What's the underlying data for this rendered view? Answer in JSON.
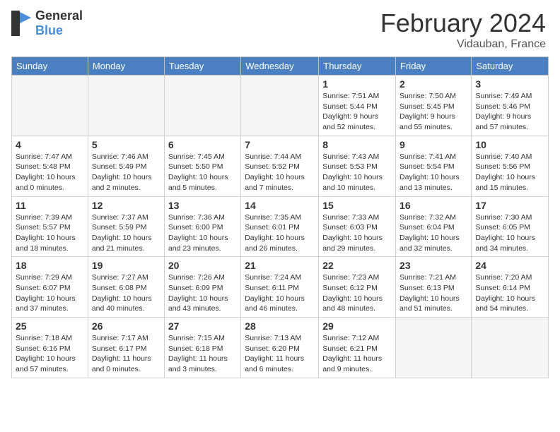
{
  "header": {
    "logo_general": "General",
    "logo_blue": "Blue",
    "month_title": "February 2024",
    "location": "Vidauban, France"
  },
  "days_of_week": [
    "Sunday",
    "Monday",
    "Tuesday",
    "Wednesday",
    "Thursday",
    "Friday",
    "Saturday"
  ],
  "weeks": [
    [
      {
        "day": "",
        "info": ""
      },
      {
        "day": "",
        "info": ""
      },
      {
        "day": "",
        "info": ""
      },
      {
        "day": "",
        "info": ""
      },
      {
        "day": "1",
        "info": "Sunrise: 7:51 AM\nSunset: 5:44 PM\nDaylight: 9 hours\nand 52 minutes."
      },
      {
        "day": "2",
        "info": "Sunrise: 7:50 AM\nSunset: 5:45 PM\nDaylight: 9 hours\nand 55 minutes."
      },
      {
        "day": "3",
        "info": "Sunrise: 7:49 AM\nSunset: 5:46 PM\nDaylight: 9 hours\nand 57 minutes."
      }
    ],
    [
      {
        "day": "4",
        "info": "Sunrise: 7:47 AM\nSunset: 5:48 PM\nDaylight: 10 hours\nand 0 minutes."
      },
      {
        "day": "5",
        "info": "Sunrise: 7:46 AM\nSunset: 5:49 PM\nDaylight: 10 hours\nand 2 minutes."
      },
      {
        "day": "6",
        "info": "Sunrise: 7:45 AM\nSunset: 5:50 PM\nDaylight: 10 hours\nand 5 minutes."
      },
      {
        "day": "7",
        "info": "Sunrise: 7:44 AM\nSunset: 5:52 PM\nDaylight: 10 hours\nand 7 minutes."
      },
      {
        "day": "8",
        "info": "Sunrise: 7:43 AM\nSunset: 5:53 PM\nDaylight: 10 hours\nand 10 minutes."
      },
      {
        "day": "9",
        "info": "Sunrise: 7:41 AM\nSunset: 5:54 PM\nDaylight: 10 hours\nand 13 minutes."
      },
      {
        "day": "10",
        "info": "Sunrise: 7:40 AM\nSunset: 5:56 PM\nDaylight: 10 hours\nand 15 minutes."
      }
    ],
    [
      {
        "day": "11",
        "info": "Sunrise: 7:39 AM\nSunset: 5:57 PM\nDaylight: 10 hours\nand 18 minutes."
      },
      {
        "day": "12",
        "info": "Sunrise: 7:37 AM\nSunset: 5:59 PM\nDaylight: 10 hours\nand 21 minutes."
      },
      {
        "day": "13",
        "info": "Sunrise: 7:36 AM\nSunset: 6:00 PM\nDaylight: 10 hours\nand 23 minutes."
      },
      {
        "day": "14",
        "info": "Sunrise: 7:35 AM\nSunset: 6:01 PM\nDaylight: 10 hours\nand 26 minutes."
      },
      {
        "day": "15",
        "info": "Sunrise: 7:33 AM\nSunset: 6:03 PM\nDaylight: 10 hours\nand 29 minutes."
      },
      {
        "day": "16",
        "info": "Sunrise: 7:32 AM\nSunset: 6:04 PM\nDaylight: 10 hours\nand 32 minutes."
      },
      {
        "day": "17",
        "info": "Sunrise: 7:30 AM\nSunset: 6:05 PM\nDaylight: 10 hours\nand 34 minutes."
      }
    ],
    [
      {
        "day": "18",
        "info": "Sunrise: 7:29 AM\nSunset: 6:07 PM\nDaylight: 10 hours\nand 37 minutes."
      },
      {
        "day": "19",
        "info": "Sunrise: 7:27 AM\nSunset: 6:08 PM\nDaylight: 10 hours\nand 40 minutes."
      },
      {
        "day": "20",
        "info": "Sunrise: 7:26 AM\nSunset: 6:09 PM\nDaylight: 10 hours\nand 43 minutes."
      },
      {
        "day": "21",
        "info": "Sunrise: 7:24 AM\nSunset: 6:11 PM\nDaylight: 10 hours\nand 46 minutes."
      },
      {
        "day": "22",
        "info": "Sunrise: 7:23 AM\nSunset: 6:12 PM\nDaylight: 10 hours\nand 48 minutes."
      },
      {
        "day": "23",
        "info": "Sunrise: 7:21 AM\nSunset: 6:13 PM\nDaylight: 10 hours\nand 51 minutes."
      },
      {
        "day": "24",
        "info": "Sunrise: 7:20 AM\nSunset: 6:14 PM\nDaylight: 10 hours\nand 54 minutes."
      }
    ],
    [
      {
        "day": "25",
        "info": "Sunrise: 7:18 AM\nSunset: 6:16 PM\nDaylight: 10 hours\nand 57 minutes."
      },
      {
        "day": "26",
        "info": "Sunrise: 7:17 AM\nSunset: 6:17 PM\nDaylight: 11 hours\nand 0 minutes."
      },
      {
        "day": "27",
        "info": "Sunrise: 7:15 AM\nSunset: 6:18 PM\nDaylight: 11 hours\nand 3 minutes."
      },
      {
        "day": "28",
        "info": "Sunrise: 7:13 AM\nSunset: 6:20 PM\nDaylight: 11 hours\nand 6 minutes."
      },
      {
        "day": "29",
        "info": "Sunrise: 7:12 AM\nSunset: 6:21 PM\nDaylight: 11 hours\nand 9 minutes."
      },
      {
        "day": "",
        "info": ""
      },
      {
        "day": "",
        "info": ""
      }
    ]
  ]
}
